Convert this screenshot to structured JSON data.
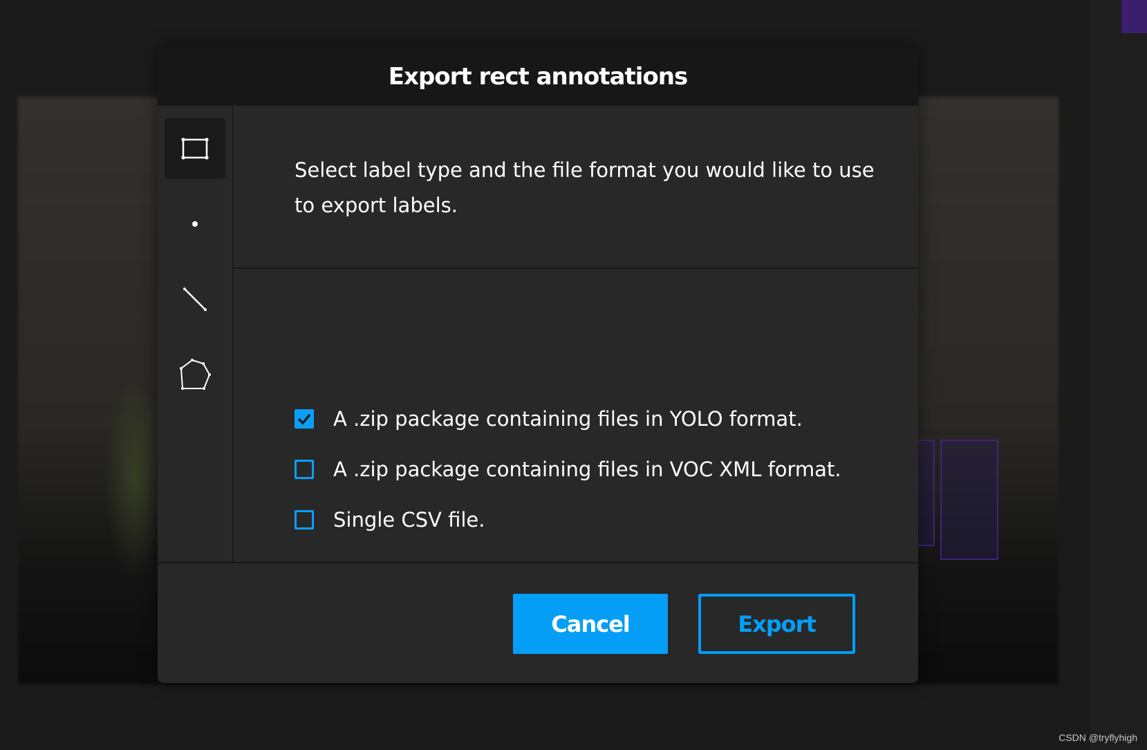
{
  "dialog": {
    "title": "Export rect annotations",
    "intro": "Select label type and the file format you would like to use to export labels."
  },
  "label_types": [
    {
      "name": "rect",
      "icon": "rect-icon",
      "active": true
    },
    {
      "name": "point",
      "icon": "point-icon",
      "active": false
    },
    {
      "name": "line",
      "icon": "line-icon",
      "active": false
    },
    {
      "name": "polygon",
      "icon": "polygon-icon",
      "active": false
    }
  ],
  "options": [
    {
      "label": "A .zip package containing files in YOLO format.",
      "checked": true
    },
    {
      "label": "A .zip package containing files in VOC XML format.",
      "checked": false
    },
    {
      "label": "Single CSV file.",
      "checked": false
    }
  ],
  "footer": {
    "cancel_label": "Cancel",
    "export_label": "Export"
  },
  "watermark": "CSDN @tryflyhigh",
  "colors": {
    "accent": "#049ef7",
    "dialog_bg": "#282828",
    "header_bg": "#171717"
  }
}
